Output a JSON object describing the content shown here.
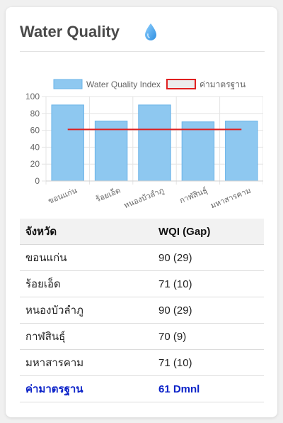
{
  "title": "Water Quality",
  "title_icon": "water-drop-icon",
  "colors": {
    "bar_fill": "#8ec8f0",
    "bar_stroke": "#6ab3e8",
    "standard_line": "#e02020",
    "wqi_value": "#1b7a1b",
    "standard_row": "#0b22c8"
  },
  "chart_data": {
    "type": "bar",
    "categories": [
      "ขอนแก่น",
      "ร้อยเอ็ด",
      "หนองบัวลำภู",
      "กาฬสินธุ์",
      "มหาสารคาม"
    ],
    "series": [
      {
        "name": "Water Quality Index",
        "values": [
          90,
          71,
          90,
          70,
          71
        ]
      },
      {
        "name": "ค่ามาตรฐาน",
        "type": "line",
        "values": [
          61,
          61,
          61,
          61,
          61
        ]
      }
    ],
    "ylim": [
      0,
      100
    ],
    "yticks": [
      0,
      20,
      40,
      60,
      80,
      100
    ],
    "grid": true,
    "legend": "top"
  },
  "table": {
    "headers": [
      "จังหวัด",
      "WQI (Gap)"
    ],
    "rows": [
      {
        "province": "ขอนแก่น",
        "wqi": "90 (29)"
      },
      {
        "province": "ร้อยเอ็ด",
        "wqi": "71 (10)"
      },
      {
        "province": "หนองบัวลำภู",
        "wqi": "90 (29)"
      },
      {
        "province": "กาฬสินธุ์",
        "wqi": "70 (9)"
      },
      {
        "province": "มหาสารคาม",
        "wqi": "71 (10)"
      }
    ],
    "standard": {
      "label": "ค่ามาตรฐาน",
      "value": "61 Dmnl"
    }
  }
}
